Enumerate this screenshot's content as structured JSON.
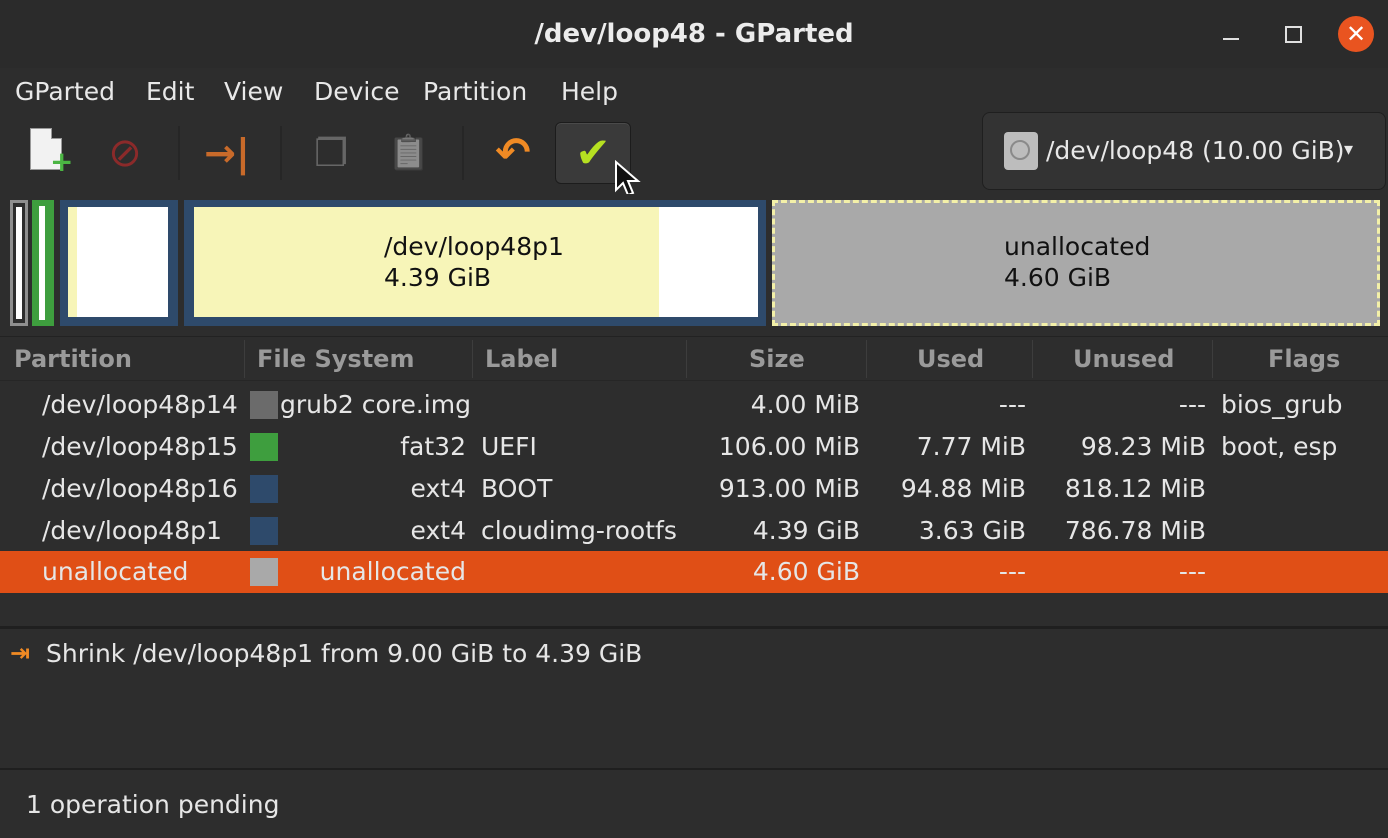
{
  "window": {
    "title": "/dev/loop48 - GParted",
    "close_glyph": "✕"
  },
  "menu": [
    "GParted",
    "Edit",
    "View",
    "Device",
    "Partition",
    "Help"
  ],
  "toolbar": {
    "icons": [
      "new-partition-icon",
      "delete-partition-icon",
      "resize-move-icon",
      "copy-icon",
      "paste-icon",
      "undo-icon",
      "apply-icon"
    ],
    "delete_glyph": "⊘",
    "resize_glyph": "→|",
    "copy_glyph": "❐",
    "paste_glyph": "📋",
    "undo_glyph": "↶",
    "apply_glyph": "✔"
  },
  "device_selector": {
    "label": "/dev/loop48 (10.00 GiB)",
    "chevron": "▾"
  },
  "disk_graphic": {
    "p1": {
      "name": "/dev/loop48p1",
      "size": "4.39 GiB"
    },
    "unallocated": {
      "name": "unallocated",
      "size": "4.60 GiB"
    }
  },
  "table": {
    "headers": [
      "Partition",
      "File System",
      "Label",
      "Size",
      "Used",
      "Unused",
      "Flags"
    ],
    "rows": [
      {
        "partition": "/dev/loop48p14",
        "fs": "grub2 core.img",
        "label": "",
        "size": "4.00 MiB",
        "used": "---",
        "unused": "---",
        "flags": "bios_grub",
        "color": "#6b6b6b"
      },
      {
        "partition": "/dev/loop48p15",
        "fs": "fat32",
        "label": "UEFI",
        "size": "106.00 MiB",
        "used": "7.77 MiB",
        "unused": "98.23 MiB",
        "flags": "boot, esp",
        "color": "#3e9e3e"
      },
      {
        "partition": "/dev/loop48p16",
        "fs": "ext4",
        "label": "BOOT",
        "size": "913.00 MiB",
        "used": "94.88 MiB",
        "unused": "818.12 MiB",
        "flags": "",
        "color": "#2e4a6b"
      },
      {
        "partition": "/dev/loop48p1",
        "fs": "ext4",
        "label": "cloudimg-rootfs",
        "size": "4.39 GiB",
        "used": "3.63 GiB",
        "unused": "786.78 MiB",
        "flags": "",
        "color": "#2e4a6b"
      },
      {
        "partition": "unallocated",
        "fs": "unallocated",
        "label": "",
        "size": "4.60 GiB",
        "used": "---",
        "unused": "---",
        "flags": "",
        "color": "#a9a9a9"
      }
    ]
  },
  "operations": {
    "icon_glyph": "⇥",
    "items": [
      "Shrink /dev/loop48p1 from 9.00 GiB to 4.39 GiB"
    ]
  },
  "status": "1 operation pending"
}
